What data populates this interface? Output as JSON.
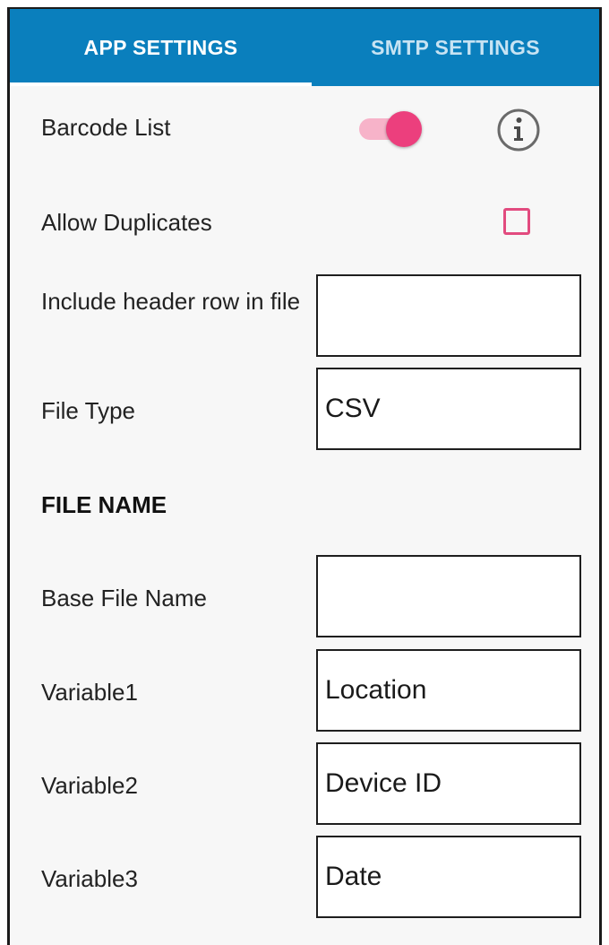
{
  "tabs": {
    "app_settings": "APP SETTINGS",
    "smtp_settings": "SMTP SETTINGS"
  },
  "settings": {
    "barcode_list": {
      "label": "Barcode List",
      "enabled": true
    },
    "allow_duplicates": {
      "label": "Allow Duplicates",
      "checked": false
    },
    "include_header": {
      "label": "Include header row in file",
      "value": ""
    },
    "file_type": {
      "label": "File Type",
      "value": "CSV"
    }
  },
  "file_name": {
    "heading": "FILE NAME",
    "base_file_name": {
      "label": "Base File Name",
      "value": ""
    },
    "variable1": {
      "label": "Variable1",
      "value": "Location"
    },
    "variable2": {
      "label": "Variable2",
      "value": "Device ID"
    },
    "variable3": {
      "label": "Variable3",
      "value": "Date"
    }
  },
  "icons": {
    "info": "info-icon"
  },
  "colors": {
    "tab_bar": "#0a7fbd",
    "accent": "#ec3f7d",
    "toggle_track": "#f7b3c9"
  }
}
